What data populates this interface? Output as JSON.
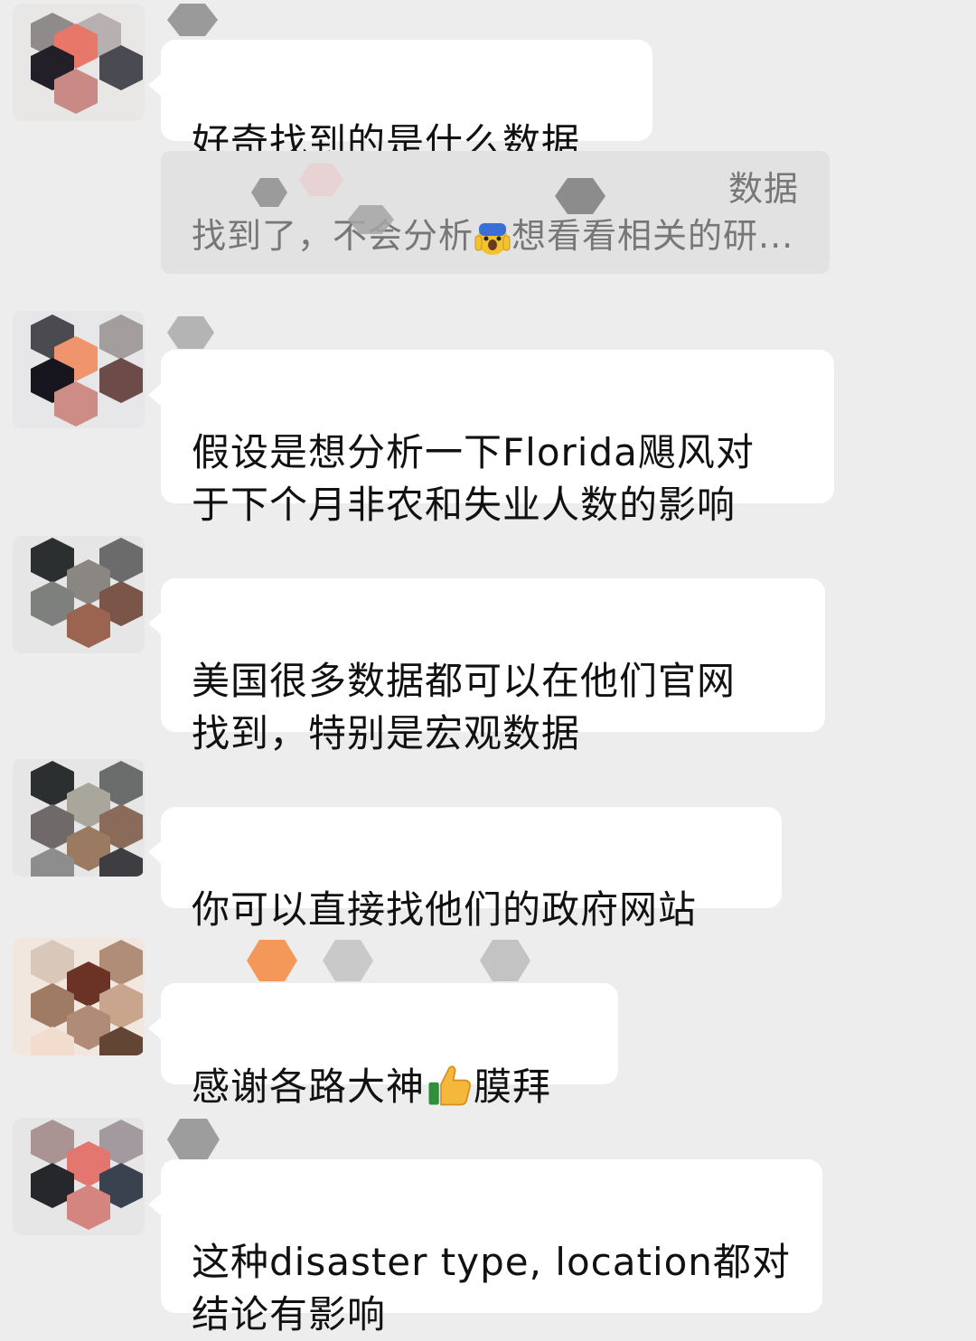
{
  "colors": {
    "background": "#ededed",
    "bubble": "#ffffff",
    "quote_background": "#e2e2e2",
    "text": "#111111",
    "quote_text": "#777777"
  },
  "messages": [
    {
      "text": "好奇找到的是什么数据",
      "avatar": "avatar-hexagon-mosaic",
      "nickname": "redacted"
    },
    {
      "text": "假设是想分析一下Florida飓风对\n于下个月非农和失业人数的影响",
      "avatar": "avatar-hexagon-mosaic",
      "nickname": "redacted"
    },
    {
      "text": "美国很多数据都可以在他们官网\n找到，特别是宏观数据",
      "avatar": "avatar-hexagon-mosaic",
      "nickname": "redacted"
    },
    {
      "text": "你可以直接找他们的政府网站",
      "avatar": "avatar-hexagon-mosaic",
      "nickname": "redacted"
    },
    {
      "text_before_emoji": "感谢各路大神",
      "emoji": "thumbs-up-icon",
      "text_after_emoji": "膜拜",
      "avatar": "avatar-hexagon-mosaic",
      "nickname": "redacted"
    },
    {
      "text": "这种disaster type, location都对\n结论有影响",
      "avatar": "avatar-hexagon-mosaic",
      "nickname": "redacted"
    }
  ],
  "quote": {
    "line1": "数据",
    "line2_before_emoji": "找到了，不会分析",
    "emoji": "scared-face-icon",
    "line2_after_emoji": "想看看相关的研..."
  }
}
